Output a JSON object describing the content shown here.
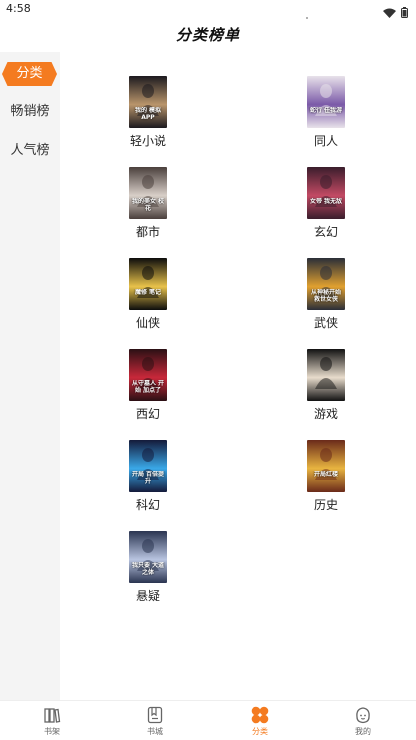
{
  "status_bar": {
    "time": "4:58",
    "icons": [
      "wifi-icon",
      "battery-icon"
    ]
  },
  "header": {
    "title": "分类榜单"
  },
  "sidebar": {
    "items": [
      {
        "label": "分类",
        "active": true
      },
      {
        "label": "畅销榜",
        "active": false
      },
      {
        "label": "人气榜",
        "active": false
      }
    ]
  },
  "categories": [
    {
      "label": "轻小说",
      "cover_text": "我的 模拟APP",
      "cover_colors": [
        "#1c1a1f",
        "#b9956b"
      ]
    },
    {
      "label": "同人",
      "cover_text": "蛇行 任我游",
      "cover_colors": [
        "#e8e2ea",
        "#7b5aa8"
      ]
    },
    {
      "label": "都市",
      "cover_text": "我的美女 校花",
      "cover_colors": [
        "#4a3f3c",
        "#d8cfc8"
      ]
    },
    {
      "label": "玄幻",
      "cover_text": "女帝 我无敌",
      "cover_colors": [
        "#3a1d2c",
        "#c24a64"
      ]
    },
    {
      "label": "仙侠",
      "cover_text": "魔修 笔记",
      "cover_colors": [
        "#0c0c0c",
        "#e8c24a"
      ]
    },
    {
      "label": "武侠",
      "cover_text": "从神秘开始 救世女侠",
      "cover_colors": [
        "#2a2e38",
        "#e0a030"
      ]
    },
    {
      "label": "西幻",
      "cover_text": "从守墓人 开始 加点了",
      "cover_colors": [
        "#2a1014",
        "#c8283a"
      ]
    },
    {
      "label": "游戏",
      "cover_text": "",
      "cover_colors": [
        "#121212",
        "#e8dccc"
      ]
    },
    {
      "label": "科幻",
      "cover_text": "开局 百倍提升",
      "cover_colors": [
        "#141a3a",
        "#3aa8e8"
      ]
    },
    {
      "label": "历史",
      "cover_text": "开局红楼",
      "cover_colors": [
        "#6a2a1a",
        "#e8b440"
      ]
    },
    {
      "label": "悬疑",
      "cover_text": "我只要 大道之体",
      "cover_colors": [
        "#2a3450",
        "#b8c4e0"
      ]
    }
  ],
  "bottom_nav": {
    "items": [
      {
        "label": "书架",
        "icon": "bookshelf-icon",
        "active": false
      },
      {
        "label": "书城",
        "icon": "bookstore-icon",
        "active": false
      },
      {
        "label": "分类",
        "icon": "category-icon",
        "active": true
      },
      {
        "label": "我的",
        "icon": "profile-icon",
        "active": false
      }
    ]
  },
  "colors": {
    "accent": "#f47b20",
    "sidebar_bg": "#f4f4f4",
    "text": "#222222"
  }
}
